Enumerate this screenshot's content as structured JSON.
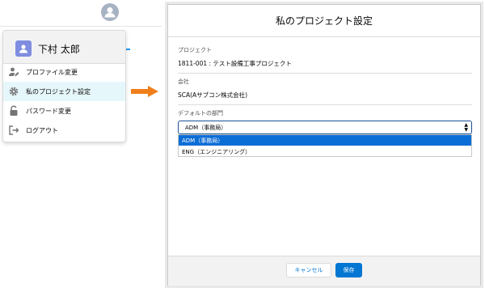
{
  "user_menu": {
    "user_name": "下村 太郎",
    "items": [
      {
        "label": "プロファイル変更",
        "icon": "user-edit-icon"
      },
      {
        "label": "私のプロジェクト設定",
        "icon": "gear-icon"
      },
      {
        "label": "パスワード変更",
        "icon": "unlock-icon"
      },
      {
        "label": "ログアウト",
        "icon": "logout-icon"
      }
    ],
    "active_index": 1
  },
  "modal": {
    "title": "私のプロジェクト設定",
    "project_label": "プロジェクト",
    "project_value": "1811-001 : テスト設備工事プロジェクト",
    "company_label": "会社",
    "company_value": "SCA(Aサブコン株式会社)",
    "department_label": "デフォルトの部門",
    "department_selected": "ADM（事務局）",
    "department_options": [
      "ADM（事務局）",
      "ENG（エンジニアリング）"
    ],
    "cancel_label": "キャンセル",
    "save_label": "保存"
  },
  "colors": {
    "accent": "#0176d3",
    "arrow": "#f07f1b",
    "selected_option": "#0b6dd6"
  }
}
